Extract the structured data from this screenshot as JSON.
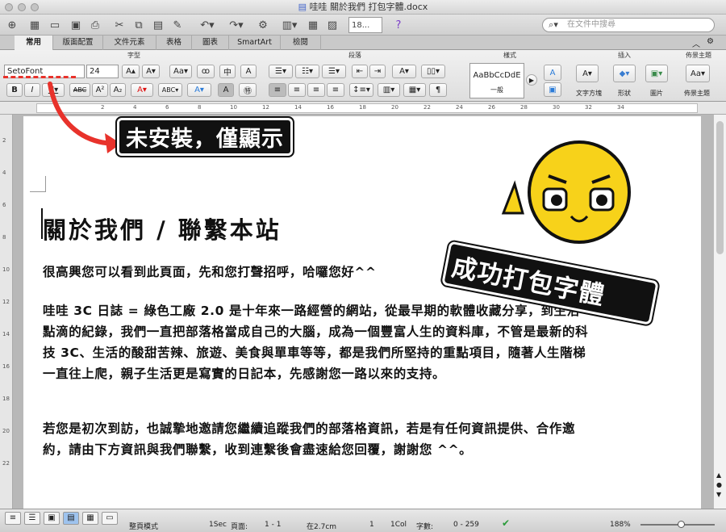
{
  "window": {
    "title": "哇哇 關於我們 打包字體.docx"
  },
  "toolbar": {
    "zoom_value": "18...",
    "search_placeholder": "在文件中搜尋"
  },
  "tabs": [
    "常用",
    "版面配置",
    "文件元素",
    "表格",
    "圖表",
    "SmartArt",
    "檢閱"
  ],
  "ribbon": {
    "font_group_label": "字型",
    "paragraph_group_label": "段落",
    "styles_group_label": "樣式",
    "insert_group_label": "插入",
    "theme_group_label": "佈景主題",
    "font_name": "SetoFont",
    "font_size": "24",
    "style_preview": "AaBbCcDdE",
    "style_name": "一般",
    "textbox_label": "文字方塊",
    "shape_label": "形狀",
    "picture_label": "圖片",
    "theme_label": "佈景主題"
  },
  "ruler": {
    "marks": [
      "2",
      "4",
      "6",
      "8",
      "10",
      "12",
      "14",
      "16",
      "18",
      "20",
      "22",
      "24",
      "26",
      "28",
      "30",
      "32",
      "34"
    ]
  },
  "vruler": {
    "marks": [
      "2",
      "4",
      "6",
      "8",
      "10",
      "12",
      "14",
      "16",
      "18",
      "20",
      "22"
    ]
  },
  "document": {
    "title": "關於我們 / 聯繫本站",
    "paragraphs": [
      "很高興您可以看到此頁面，先和您打聲招呼，哈囉您好^^",
      "哇哇 3C 日誌 = 綠色工廠 2.0 是十年來一路經營的網站，從最早期的軟體收藏分享，到生活點滴的紀錄，我們一直把部落格當成自己的大腦，成為一個豐富人生的資料庫，不管是最新的科技 3C、生活的酸甜苦辣、旅遊、美食與單車等等，都是我們所堅持的重點項目，隨著人生階梯一直往上爬，親子生活更是寫實的日記本，先感謝您一路以來的支持。",
      "若您是初次到訪，也誠摯地邀請您繼續追蹤我們的部落格資訊，若是有任何資訊提供、合作邀約，請由下方資訊與我們聯繫，收到連繫後會盡速給您回覆，謝謝您 ^^。"
    ]
  },
  "annotations": {
    "not_installed": "未安裝，僅顯示",
    "success": "成功打包字體"
  },
  "status": {
    "view_mode": "整頁模式",
    "section": "1Sec",
    "page_label": "頁面:",
    "page_value": "1 - 1",
    "position": "在2.7cm",
    "line": "1",
    "col": "1Col",
    "word_label": "字數:",
    "word_value": "0 - 259",
    "zoom": "188%"
  },
  "colors": {
    "arrow": "#e8322b",
    "emoji_face": "#f7d21a",
    "callout_bg": "#111111"
  }
}
